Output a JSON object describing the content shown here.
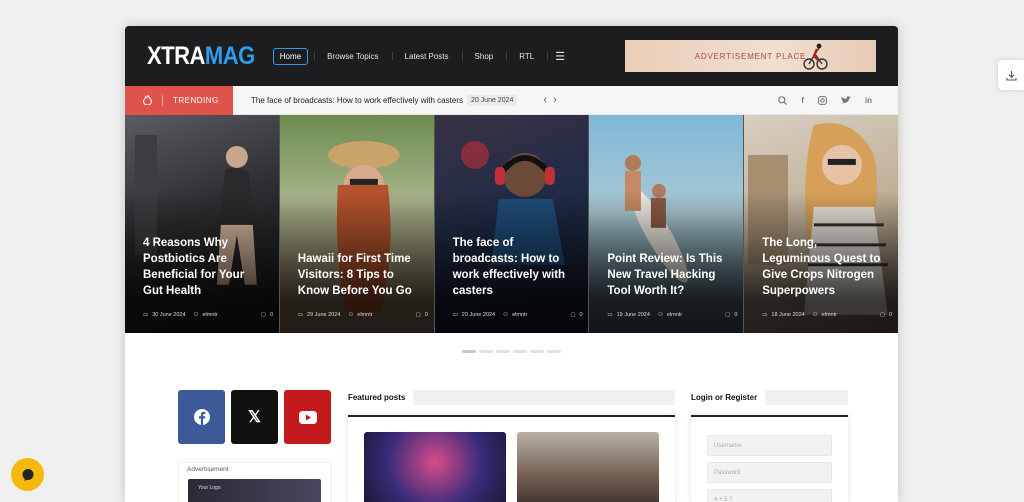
{
  "header": {
    "logo_part1": "XTRA",
    "logo_part2": "MAG",
    "nav": [
      "Home",
      "Browse Topics",
      "Latest Posts",
      "Shop",
      "RTL"
    ],
    "menu_icon": "hamburger-icon",
    "ad_text": "ADVERTISEMENT PLACE"
  },
  "trending": {
    "label": "TRENDING",
    "headline": "The face of broadcasts: How to work effectively with casters",
    "date": "20 June 2024",
    "social_icons": [
      "search-icon",
      "facebook-icon",
      "instagram-icon",
      "twitter-icon",
      "linkedin-icon"
    ]
  },
  "slides": [
    {
      "title": "4 Reasons Why Postbiotics Are Beneficial for Your Gut Health",
      "date": "30 June 2024",
      "author": "elmntr",
      "comments": "0"
    },
    {
      "title": "Hawaii for First Time Visitors: 8 Tips to Know Before You Go",
      "date": "29 June 2024",
      "author": "elmntr",
      "comments": "0"
    },
    {
      "title": "The face of broadcasts: How to work effectively with casters",
      "date": "20 June 2024",
      "author": "elmntr",
      "comments": "0"
    },
    {
      "title": "Point Review: Is This New Travel Hacking Tool Worth It?",
      "date": "19 June 2024",
      "author": "elmntr",
      "comments": "0"
    },
    {
      "title": "The Long, Leguminous Quest to Give Crops Nitrogen Superpowers",
      "date": "18 June 2024",
      "author": "elmntr",
      "comments": "0"
    }
  ],
  "sidebar": {
    "advertisement_label": "Advertisement",
    "ad_logo": "Your Logo"
  },
  "featured": {
    "heading": "Featured posts"
  },
  "login": {
    "heading": "Login or Register",
    "username_placeholder": "Username",
    "password_placeholder": "Password",
    "captcha": "4 + 5 ?"
  },
  "colors": {
    "accent": "#2f9bea",
    "trending": "#e0534d",
    "header_bg": "#1d1d1f"
  }
}
